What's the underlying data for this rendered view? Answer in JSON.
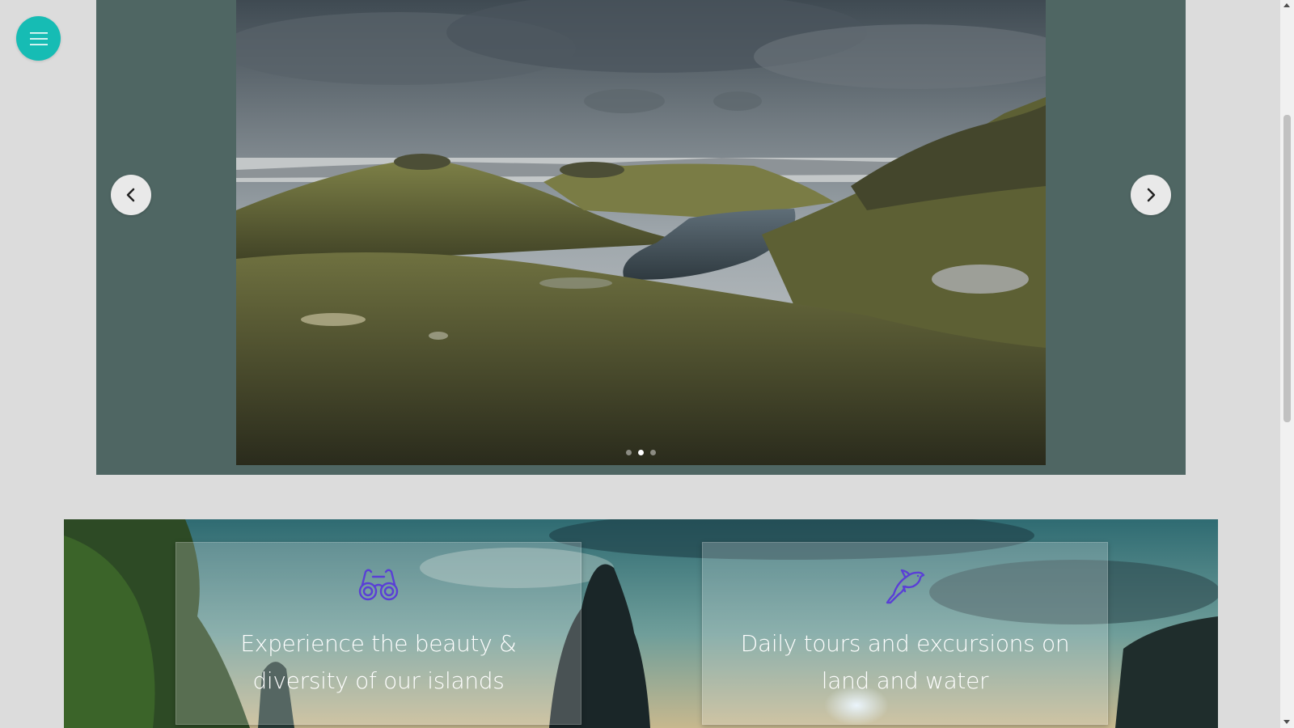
{
  "menu": {
    "icon": "hamburger-menu-icon",
    "color": "#16bcb4"
  },
  "slider": {
    "background": "#4f6663",
    "prev_icon": "chevron-left-icon",
    "next_icon": "chevron-right-icon",
    "slide_count": 3,
    "active_slide": 2,
    "image": "mountain-lake-landscape"
  },
  "features": {
    "background_image": "person-looking-at-coastal-cliffs",
    "cards": [
      {
        "icon": "binoculars-icon",
        "text": "Experience the beauty & diversity of our islands"
      },
      {
        "icon": "dolphin-icon",
        "text": "Daily tours and excursions on land and water"
      }
    ],
    "icon_color": "#5a3fd6"
  }
}
